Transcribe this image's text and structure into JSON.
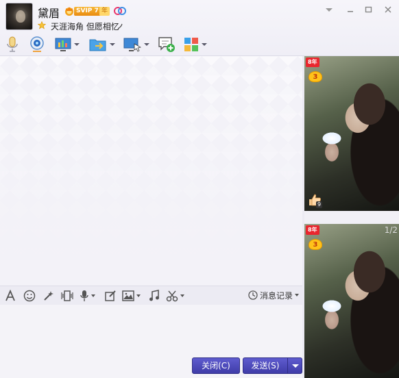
{
  "header": {
    "nickname": "黛眉",
    "vip_label": "SVIP 7",
    "year_label": "年",
    "signature": "天涯海角 但愿相忆"
  },
  "toolbar": {
    "items": [
      {
        "icon": "microphone-icon"
      },
      {
        "icon": "webcam-icon"
      },
      {
        "icon": "screen-share-icon"
      },
      {
        "icon": "file-transfer-icon"
      },
      {
        "icon": "remote-desktop-icon"
      },
      {
        "icon": "new-discussion-icon"
      },
      {
        "icon": "apps-icon"
      }
    ]
  },
  "input_toolbar": {
    "history_label": "消息记录",
    "items": [
      "font-icon",
      "emoji-icon",
      "magic-icon",
      "shake-icon",
      "voice-icon",
      "edit-icon",
      "image-icon",
      "music-icon",
      "screenshot-icon"
    ]
  },
  "buttons": {
    "close_label": "关闭(C)",
    "send_label": "发送(S)"
  },
  "profile_panel": {
    "year_tag": "8年",
    "rank_top": "3",
    "rank_bottom": "3",
    "like_count": "9",
    "page_indicator": "1/2"
  },
  "colors": {
    "accent": "#4a47b8",
    "vip": "#f1a11b",
    "year_tag": "#e9262e"
  }
}
